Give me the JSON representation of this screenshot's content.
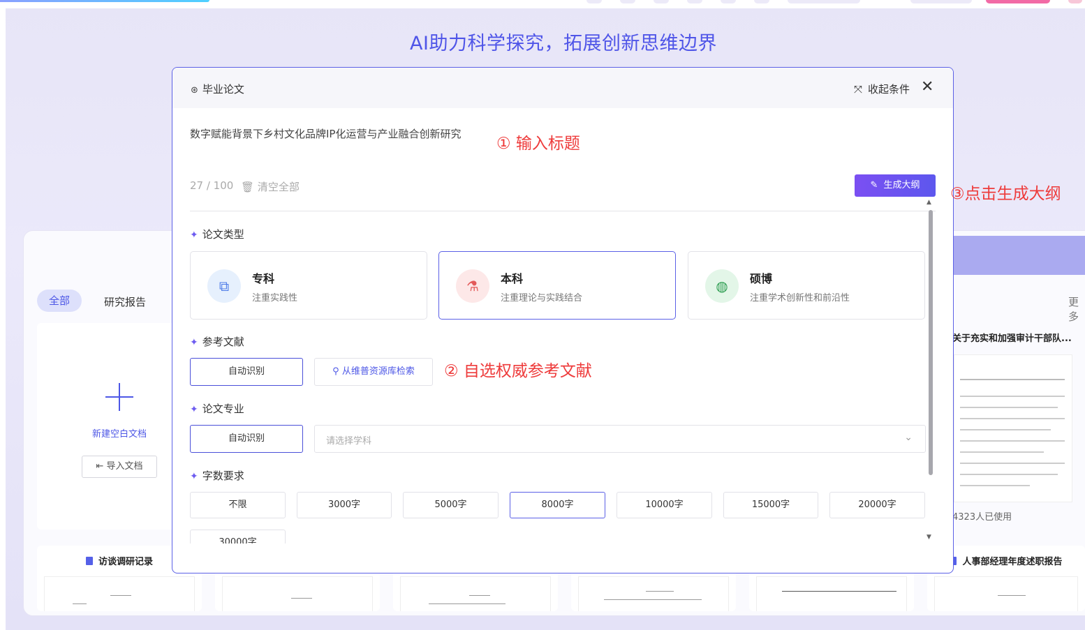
{
  "hero": {
    "title": "AI助力科学探究，拓展创新思维边界"
  },
  "background": {
    "tabs": {
      "all": "全部",
      "research": "研究报告",
      "more": "更多"
    },
    "new_doc": {
      "label": "新建空白文档",
      "import_label": "导入文档"
    },
    "featured": {
      "title": "关于充实和加强审计干部队...",
      "usage": "4323人已使用"
    },
    "bottom_cards": [
      {
        "title": "访谈调研记录"
      },
      {
        "title": ""
      },
      {
        "title": ""
      },
      {
        "title": ""
      },
      {
        "title": ""
      },
      {
        "title": "人事部经理年度述职报告"
      }
    ]
  },
  "dialog": {
    "title": "毕业论文",
    "collapse_label": "收起条件",
    "topic_text": "数字赋能背景下乡村文化品牌IP化运营与产业融合创新研究",
    "counter": "27 / 100",
    "clear_label": "清空全部",
    "generate_label": "生成大纲",
    "sections": {
      "paper_type": "论文类型",
      "references": "参考文献",
      "major": "论文专业",
      "word_count": "字数要求"
    },
    "paper_types": [
      {
        "name": "专科",
        "desc": "注重实践性",
        "icon": "puzzle-icon",
        "selected": false
      },
      {
        "name": "本科",
        "desc": "注重理论与实践结合",
        "icon": "flask-icon",
        "selected": true
      },
      {
        "name": "硕博",
        "desc": "注重学术创新性和前沿性",
        "icon": "globe-icon",
        "selected": false
      }
    ],
    "references": {
      "auto_label": "自动识别",
      "search_label": "从维普资源库检索"
    },
    "major": {
      "auto_label": "自动识别",
      "placeholder": "请选择学科"
    },
    "word_counts": [
      "不限",
      "3000字",
      "5000字",
      "8000字",
      "10000字",
      "15000字",
      "20000字",
      "30000字"
    ],
    "selected_word_count": "8000字"
  },
  "annotations": {
    "step1": "① 输入标题",
    "step2": "② 自选权威参考文献",
    "step3": "③点击生成大纲"
  },
  "colors": {
    "accent": "#5b60e6",
    "annotation": "#ee3b3b",
    "generate_start": "#7b4ff2",
    "generate_end": "#5d57ee"
  }
}
